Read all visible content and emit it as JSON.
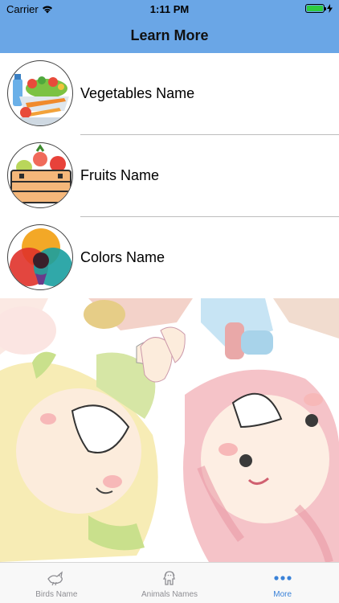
{
  "status_bar": {
    "carrier": "Carrier",
    "time": "1:11 PM",
    "battery_level": 1.0
  },
  "nav": {
    "title": "Learn More"
  },
  "list": {
    "items": [
      {
        "label": "Vegetables Name",
        "icon": "vegetables-icon"
      },
      {
        "label": "Fruits Name",
        "icon": "fruit-crate-icon"
      },
      {
        "label": "Colors Name",
        "icon": "color-wheel-icon"
      }
    ]
  },
  "tabbar": {
    "tabs": [
      {
        "label": "Birds Name",
        "icon": "bird-icon",
        "active": false
      },
      {
        "label": "Animals Names",
        "icon": "dog-icon",
        "active": false
      },
      {
        "label": "More",
        "icon": "more-dots-icon",
        "active": true
      }
    ]
  },
  "colors": {
    "nav_bar": "#6aa6e6",
    "active_tab": "#3a82d8",
    "inactive_tab": "#8e8e93"
  }
}
